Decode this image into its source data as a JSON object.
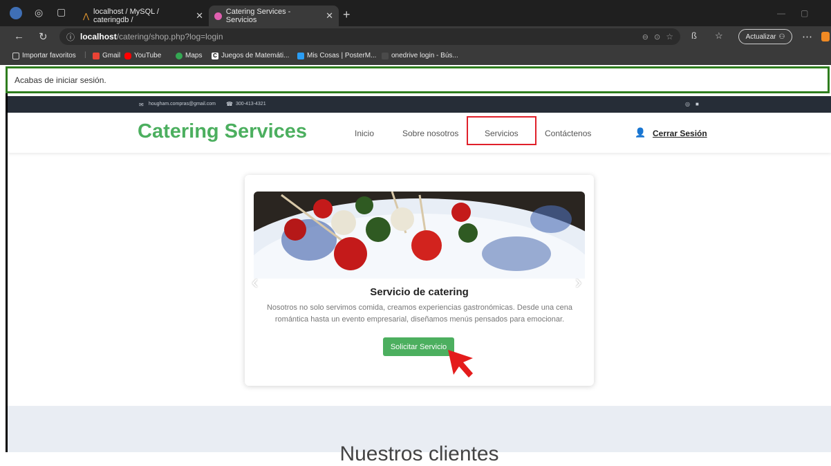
{
  "browser": {
    "tabs": [
      {
        "label": "localhost / MySQL / cateringdb /"
      },
      {
        "label": "Catering Services - Servicios"
      }
    ],
    "url_host": "localhost",
    "url_path": "/catering/shop.php?log=login",
    "update_label": "Actualizar",
    "favorites": [
      {
        "label": "Importar favoritos",
        "color": "#cfcfcf"
      },
      {
        "label": "Gmail",
        "color": "#ea4335"
      },
      {
        "label": "YouTube",
        "color": "#ff0000"
      },
      {
        "label": "Maps",
        "color": "#34a853"
      },
      {
        "label": "Juegos de Matemáti...",
        "color": "#ffffff"
      },
      {
        "label": "Mis Cosas | PosterM...",
        "color": "#2a9df4"
      },
      {
        "label": "onedrive login - Bús...",
        "color": "#3a3a3a"
      }
    ]
  },
  "alert": {
    "text": "Acabas de iniciar sesión."
  },
  "topbar": {
    "email": "hougham.compras@gmail.com",
    "phone": "300-413-4321"
  },
  "navbar": {
    "brand": "Catering Services",
    "links": [
      "Inicio",
      "Sobre nosotros",
      "Servicios",
      "Contáctenos"
    ],
    "logout": "Cerrar Sesión"
  },
  "card": {
    "title": "Servicio de catering",
    "description": "Nosotros no solo servimos comida, creamos experiencias gastronómicas. Desde una cena romántica hasta un evento empresarial, diseñamos menús pensados para emocionar.",
    "button": "Solicitar Servicio"
  },
  "bottom": {
    "heading": "Nuestros clientes"
  },
  "colors": {
    "brand": "#4caf5f",
    "highlight": "#e0202a",
    "topstrip": "#262d37"
  }
}
